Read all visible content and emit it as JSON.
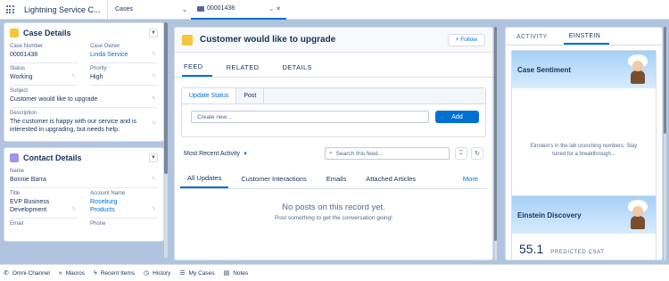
{
  "topnav": {
    "app_name": "Lightning Service C...",
    "nav_select": "Cases",
    "chevron": "⌄",
    "tab_label": "00001438",
    "tab_controls": "⌄ ✕"
  },
  "case_details": {
    "title": "Case Details",
    "case_number_label": "Case Number",
    "case_number": "00001438",
    "case_owner_label": "Case Owner",
    "case_owner": "Linda Service",
    "status_label": "Status",
    "status": "Working",
    "priority_label": "Priority",
    "priority": "High",
    "subject_label": "Subject",
    "subject": "Customer would like to upgrade",
    "description_label": "Description",
    "description": "The customer is happy with our service and is interested in upgrading, but needs help."
  },
  "contact_details": {
    "title": "Contact Details",
    "name_label": "Name",
    "name": "Bonnie Barra",
    "title_label": "Title",
    "title_value": "EVP Business Development",
    "account_label": "Account Name",
    "account": "Roseburg Products",
    "email_label": "Email",
    "phone_label": "Phone"
  },
  "center": {
    "title": "Customer would like to upgrade",
    "follow": "+ Follow",
    "tabs": [
      "FEED",
      "RELATED",
      "DETAILS"
    ],
    "publisher_tabs": [
      "Update Status",
      "Post"
    ],
    "publisher_placeholder": "Create new...",
    "add_button": "Add",
    "sort_label": "Most Recent Activity",
    "search_placeholder": "Search this feed...",
    "subtabs": [
      "All Updates",
      "Customer Interactions",
      "Emails",
      "Attached Articles",
      "More"
    ],
    "empty_title": "No posts on this record yet.",
    "empty_sub": "Post something to get the conversation going!"
  },
  "right": {
    "tabs": [
      "ACTIVITY",
      "EINSTEIN"
    ],
    "sentiment_title": "Case Sentiment",
    "sentiment_msg": "Einstein's in the lab crunching numbers. Stay tuned for a breakthrough...",
    "discovery_title": "Einstein Discovery",
    "csat_value": "55.1",
    "csat_label": "PREDICTED CSAT"
  },
  "utility": [
    {
      "icon": "omni-channel-icon",
      "label": "Omni-Channel"
    },
    {
      "icon": "macros-icon",
      "label": "Macros"
    },
    {
      "icon": "recent-items-icon",
      "label": "Recent Items"
    },
    {
      "icon": "history-icon",
      "label": "History"
    },
    {
      "icon": "my-cases-icon",
      "label": "My Cases"
    },
    {
      "icon": "notes-icon",
      "label": "Notes"
    }
  ],
  "colors": {
    "brand": "#0070d2",
    "case_icon": "#f8c43a",
    "contact_icon": "#a094ed",
    "background": "#b0c4df"
  }
}
